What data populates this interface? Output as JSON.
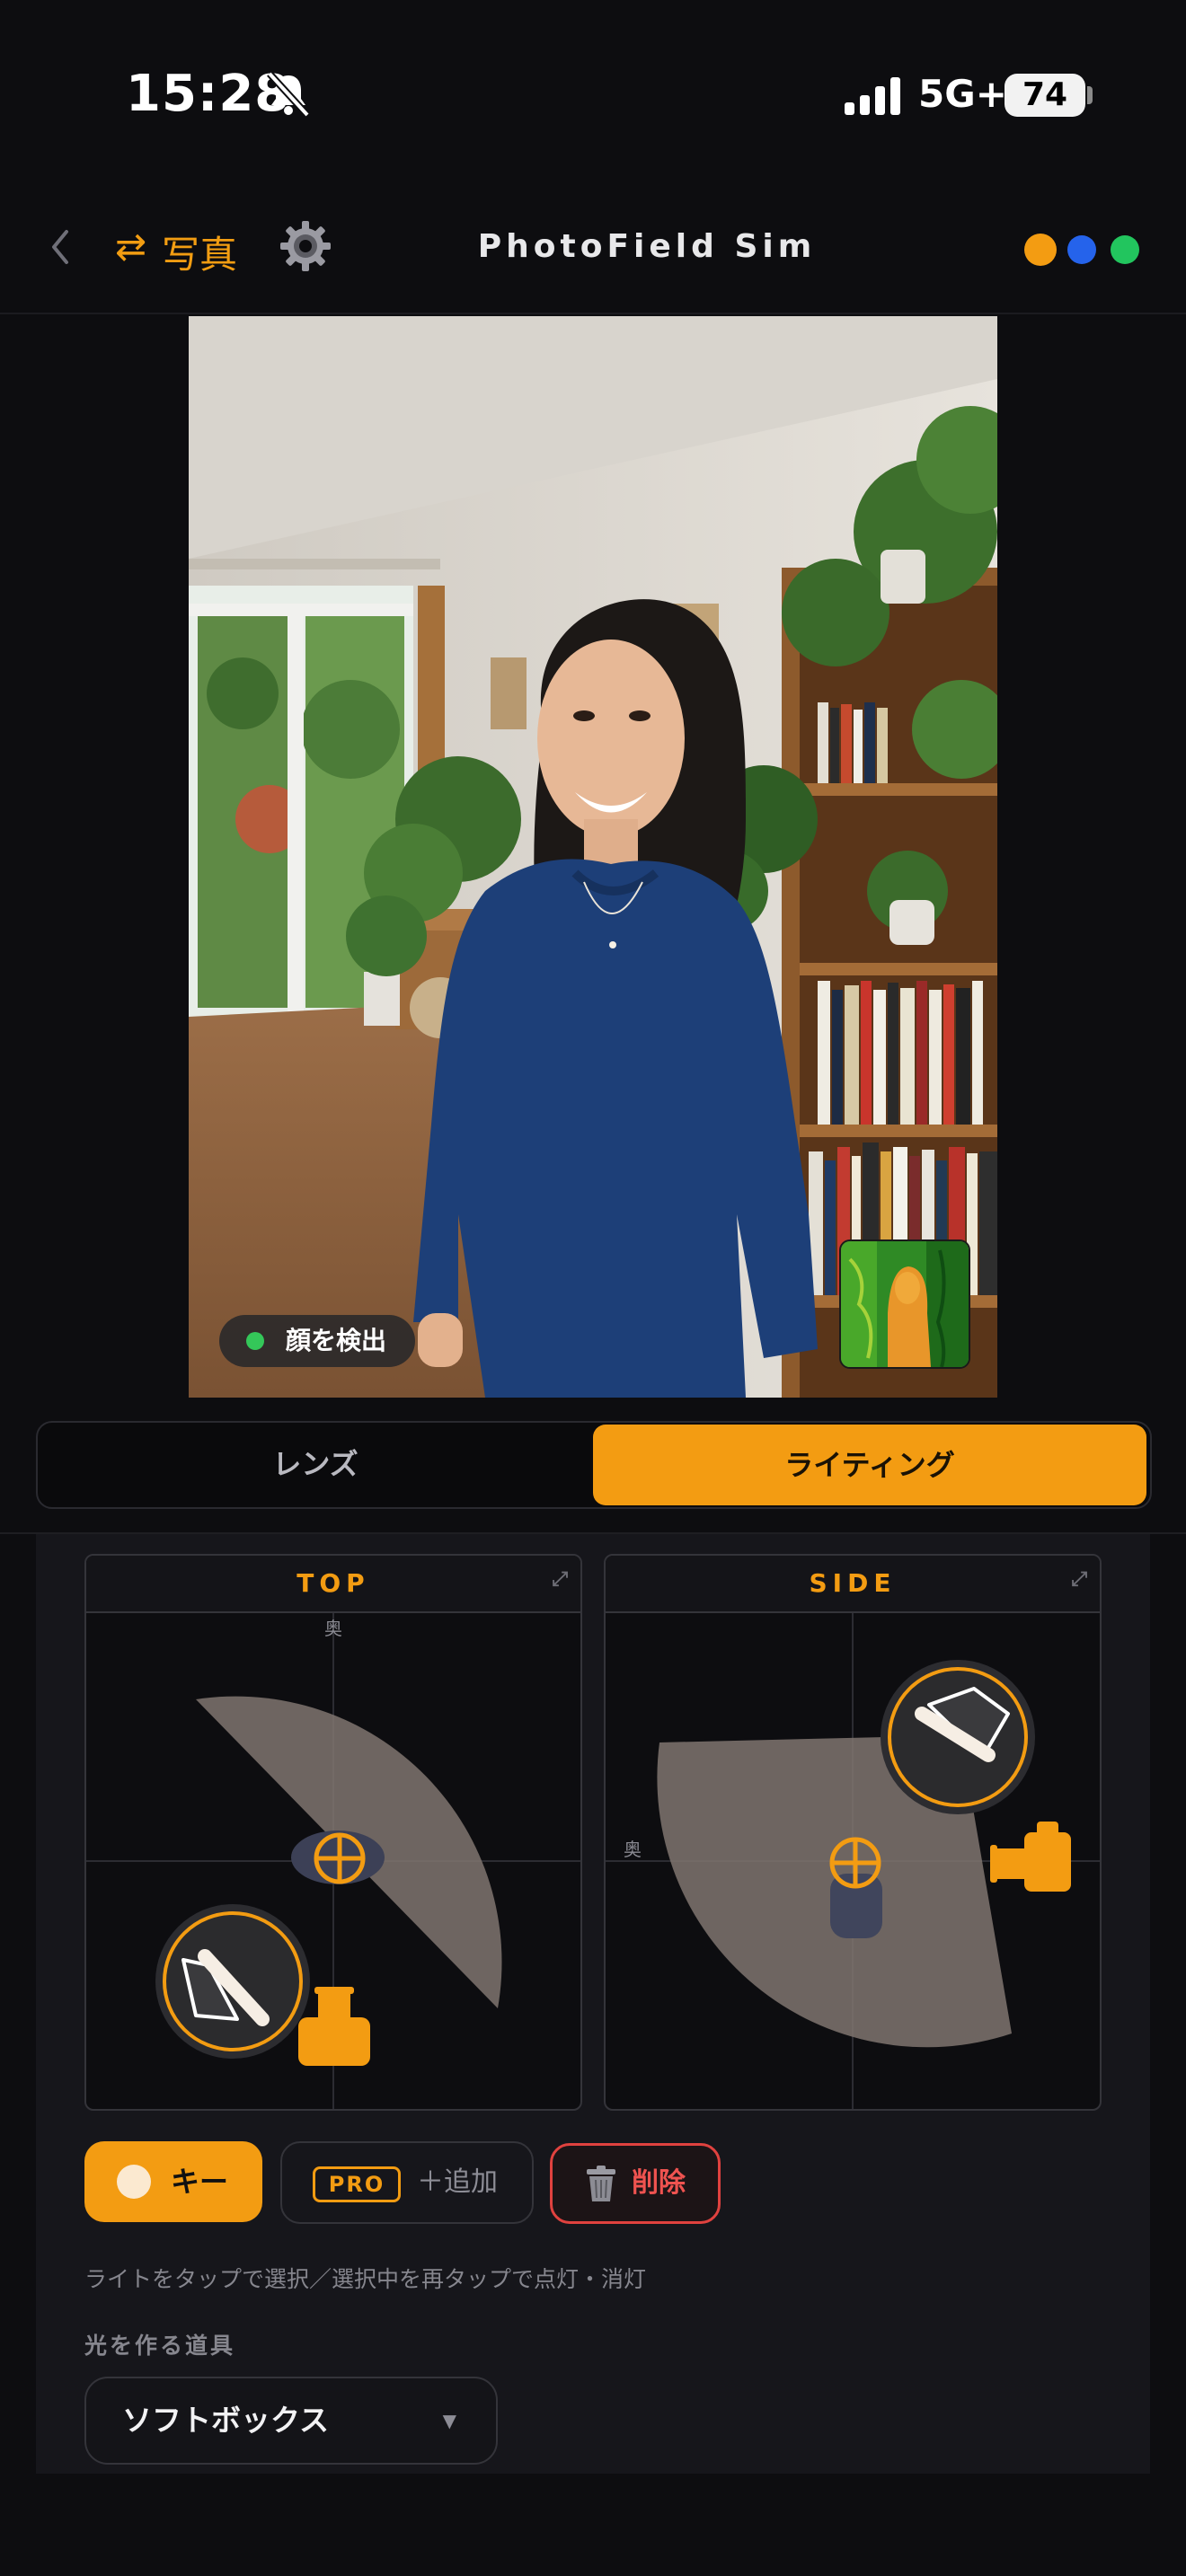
{
  "status_bar": {
    "time": "15:28",
    "network": "5G+",
    "battery": "74"
  },
  "nav": {
    "swap_symbol": "⇄",
    "photo_label": "写真",
    "title": "PhotoField Sim",
    "dots": [
      "#f39c12",
      "#2563eb",
      "#22c55e"
    ]
  },
  "photo": {
    "face_badge": "顔を検出"
  },
  "tabs": {
    "lens": "レンズ",
    "lighting": "ライティング",
    "active": "lighting"
  },
  "views": {
    "top": {
      "title": "TOP",
      "back_label": "奥",
      "expand": "⤢"
    },
    "side": {
      "title": "SIDE",
      "back_label": "奥",
      "expand": "⤢"
    }
  },
  "actions": {
    "key_label": "キー",
    "pro_badge": "PRO",
    "add_label": "＋追加",
    "delete_label": "削除"
  },
  "hint": "ライトをタップで選択／選択中を再タップで点灯・消灯",
  "tools": {
    "label": "光を作る道具",
    "selected": "ソフトボックス"
  },
  "colors": {
    "accent": "#f39c12",
    "danger": "#e0423f",
    "background": "#0d0d10"
  }
}
